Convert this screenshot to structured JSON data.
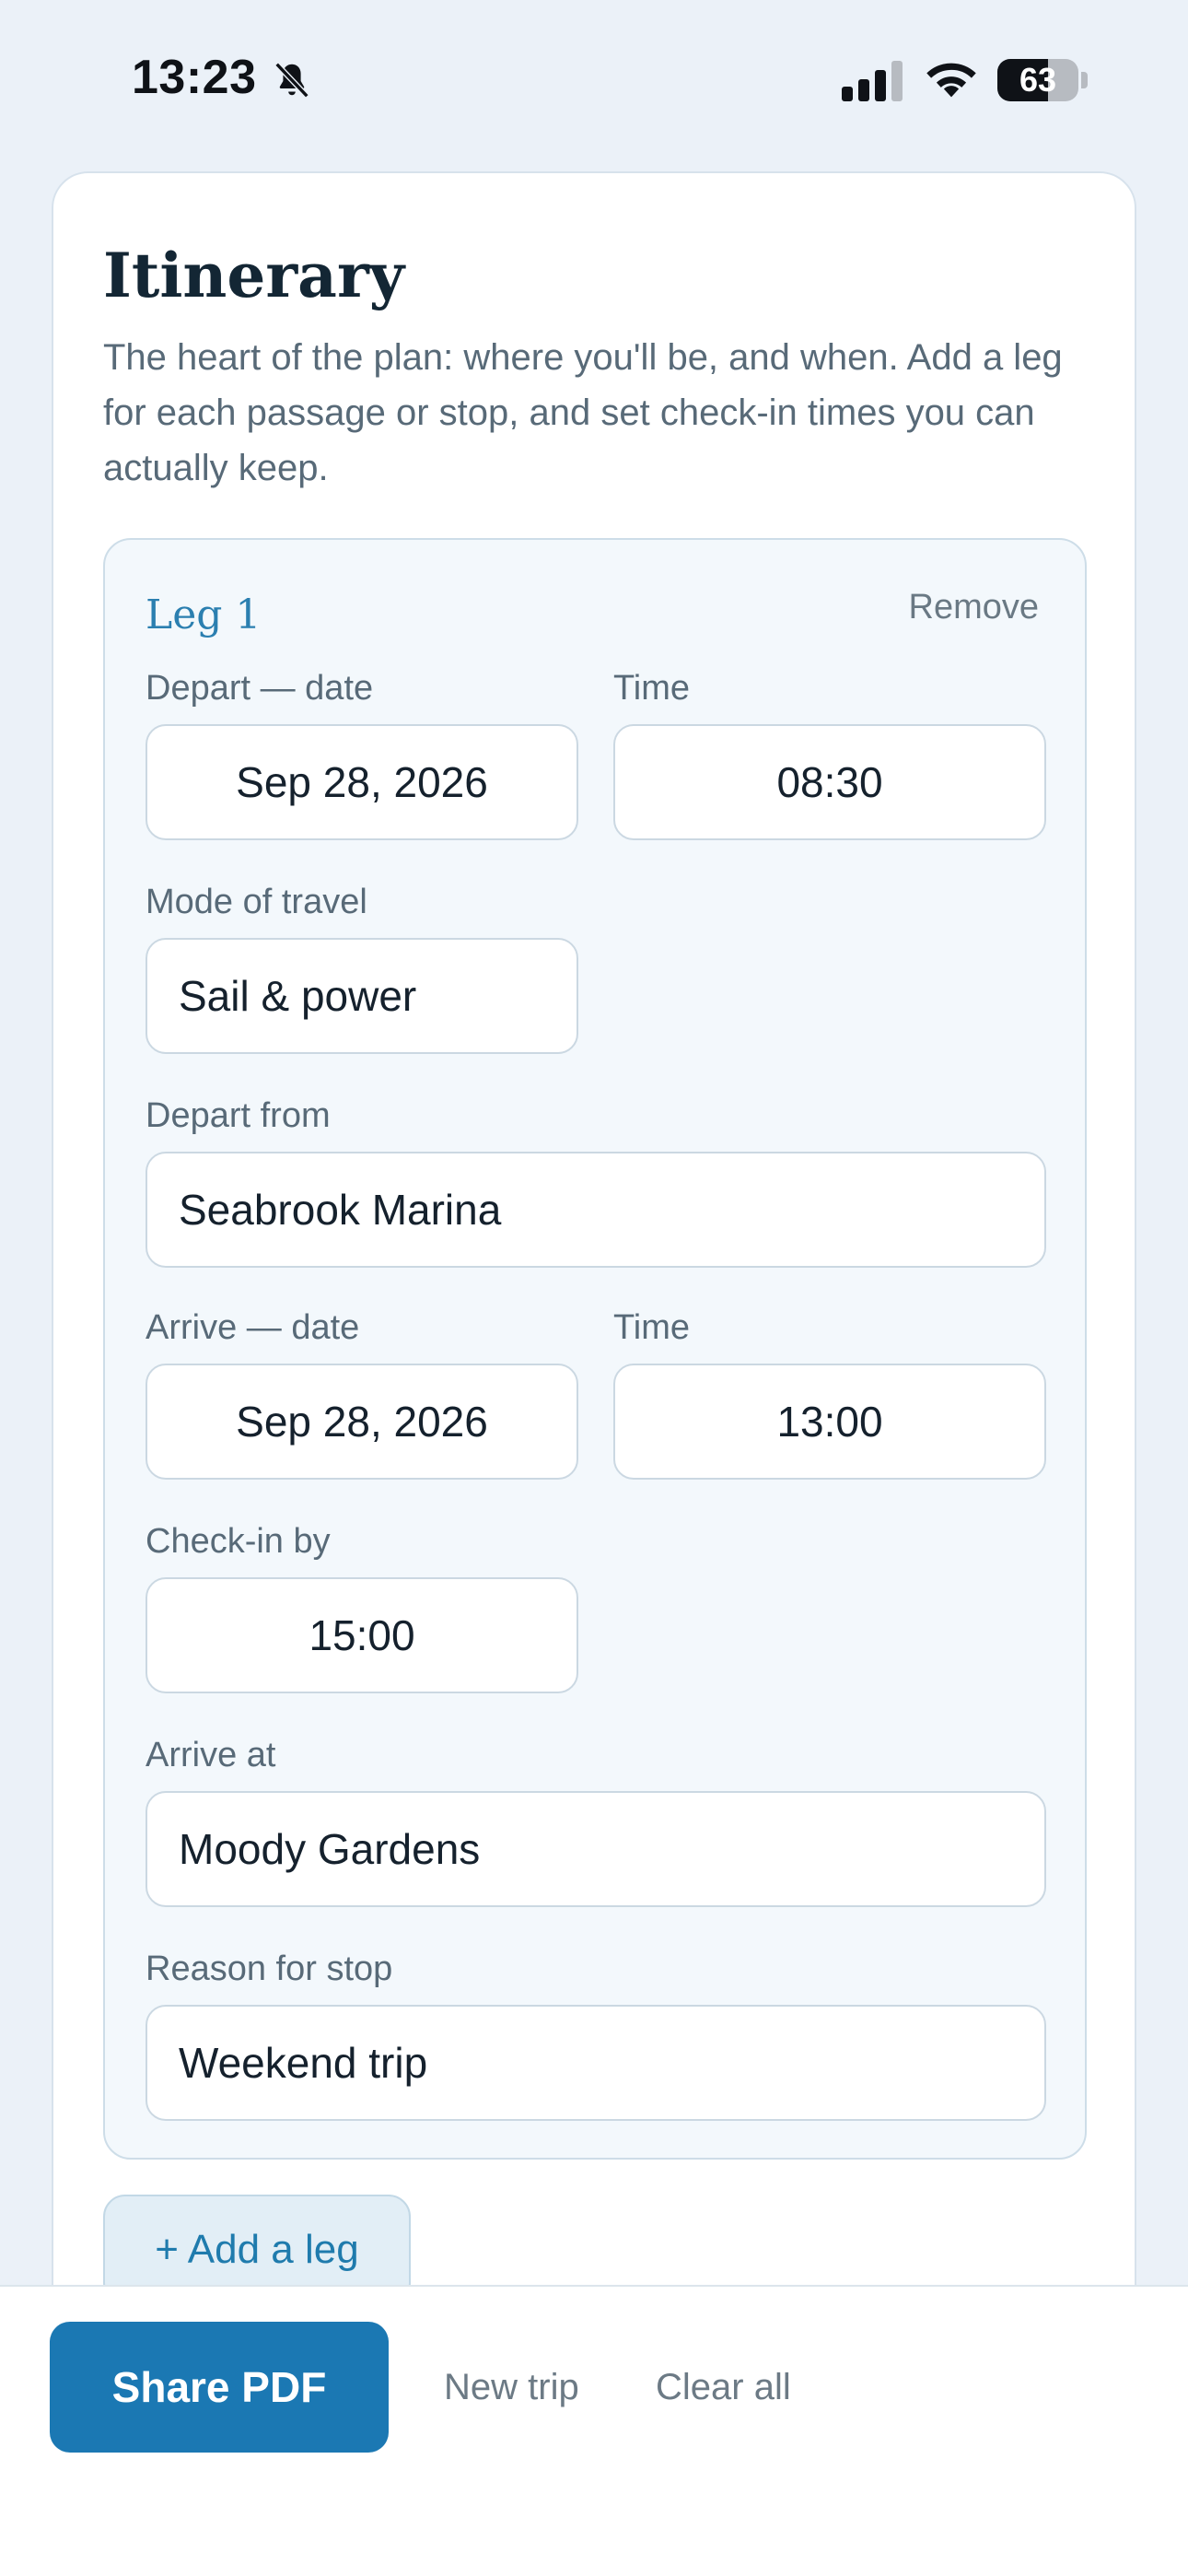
{
  "status": {
    "time": "13:23",
    "battery": "63",
    "battery_level": 0.63
  },
  "itinerary": {
    "title": "Itinerary",
    "description": "The heart of the plan: where you'll be, and when. Add a leg for each passage or stop, and set check-in times you can actually keep.",
    "leg": {
      "title": "Leg 1",
      "remove_label": "Remove",
      "depart_date_label": "Depart — date",
      "depart_date": "Sep 28, 2026",
      "depart_time_label": "Time",
      "depart_time": "08:30",
      "mode_label": "Mode of travel",
      "mode": "Sail & power",
      "depart_from_label": "Depart from",
      "depart_from": "Seabrook Marina",
      "arrive_date_label": "Arrive — date",
      "arrive_date": "Sep 28, 2026",
      "arrive_time_label": "Time",
      "arrive_time": "13:00",
      "checkin_label": "Check-in by",
      "checkin": "15:00",
      "arrive_at_label": "Arrive at",
      "arrive_at": "Moody Gardens",
      "reason_label": "Reason for stop",
      "reason": "Weekend trip"
    },
    "add_leg_label": "+ Add a leg"
  },
  "bottom_bar": {
    "share_label": "Share PDF",
    "new_trip_label": "New trip",
    "clear_all_label": "Clear all"
  }
}
